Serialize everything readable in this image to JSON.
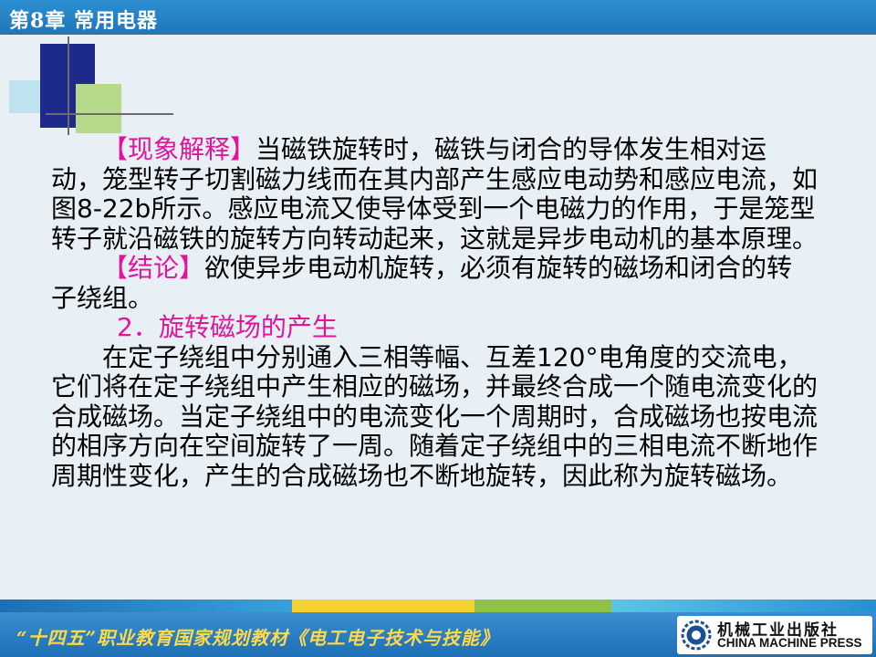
{
  "header": {
    "chapter_title": "第8章  常用电器"
  },
  "content": {
    "para1_label": "【现象解释】",
    "para1_text": "当磁铁旋转时，磁铁与闭合的导体发生相对运动，笼型转子切割磁力线而在其内部产生感应电动势和感应电流，如图8-22b所示。感应电流又使导体受到一个电磁力的作用，于是笼型转子就沿磁铁的旋转方向转动起来，这就是异步电动机的基本原理。",
    "para2_label": "【结论】",
    "para2_text": "欲使异步电动机旋转，必须有旋转的磁场和闭合的转子绕组。",
    "subheading": "2．旋转磁场的产生",
    "para3_text": "在定子绕组中分别通入三相等幅、互差120°电角度的交流电，它们将在定子绕组中产生相应的磁场，并最终合成一个随电流变化的合成磁场。当定子绕组中的电流变化一个周期时，合成磁场也按电流的相序方向在空间旋转了一周。随着定子绕组中的三相电流不断地作周期性变化，产生的合成磁场也不断地旋转，因此称为旋转磁场。"
  },
  "footer": {
    "series_title": "“十四五”职业教育国家规划教材《电工电子技术与技能》",
    "publisher_cn": "机械工业出版社",
    "publisher_en": "CHINA MACHINE PRESS"
  },
  "colors": {
    "header_blue": "#1f76b8",
    "highlight_magenta": "#e0159c",
    "series_title_yellow": "#ffd94a",
    "background": "#e8f0f6"
  },
  "icons": {
    "publisher_logo": "gear-emblem-icon"
  }
}
